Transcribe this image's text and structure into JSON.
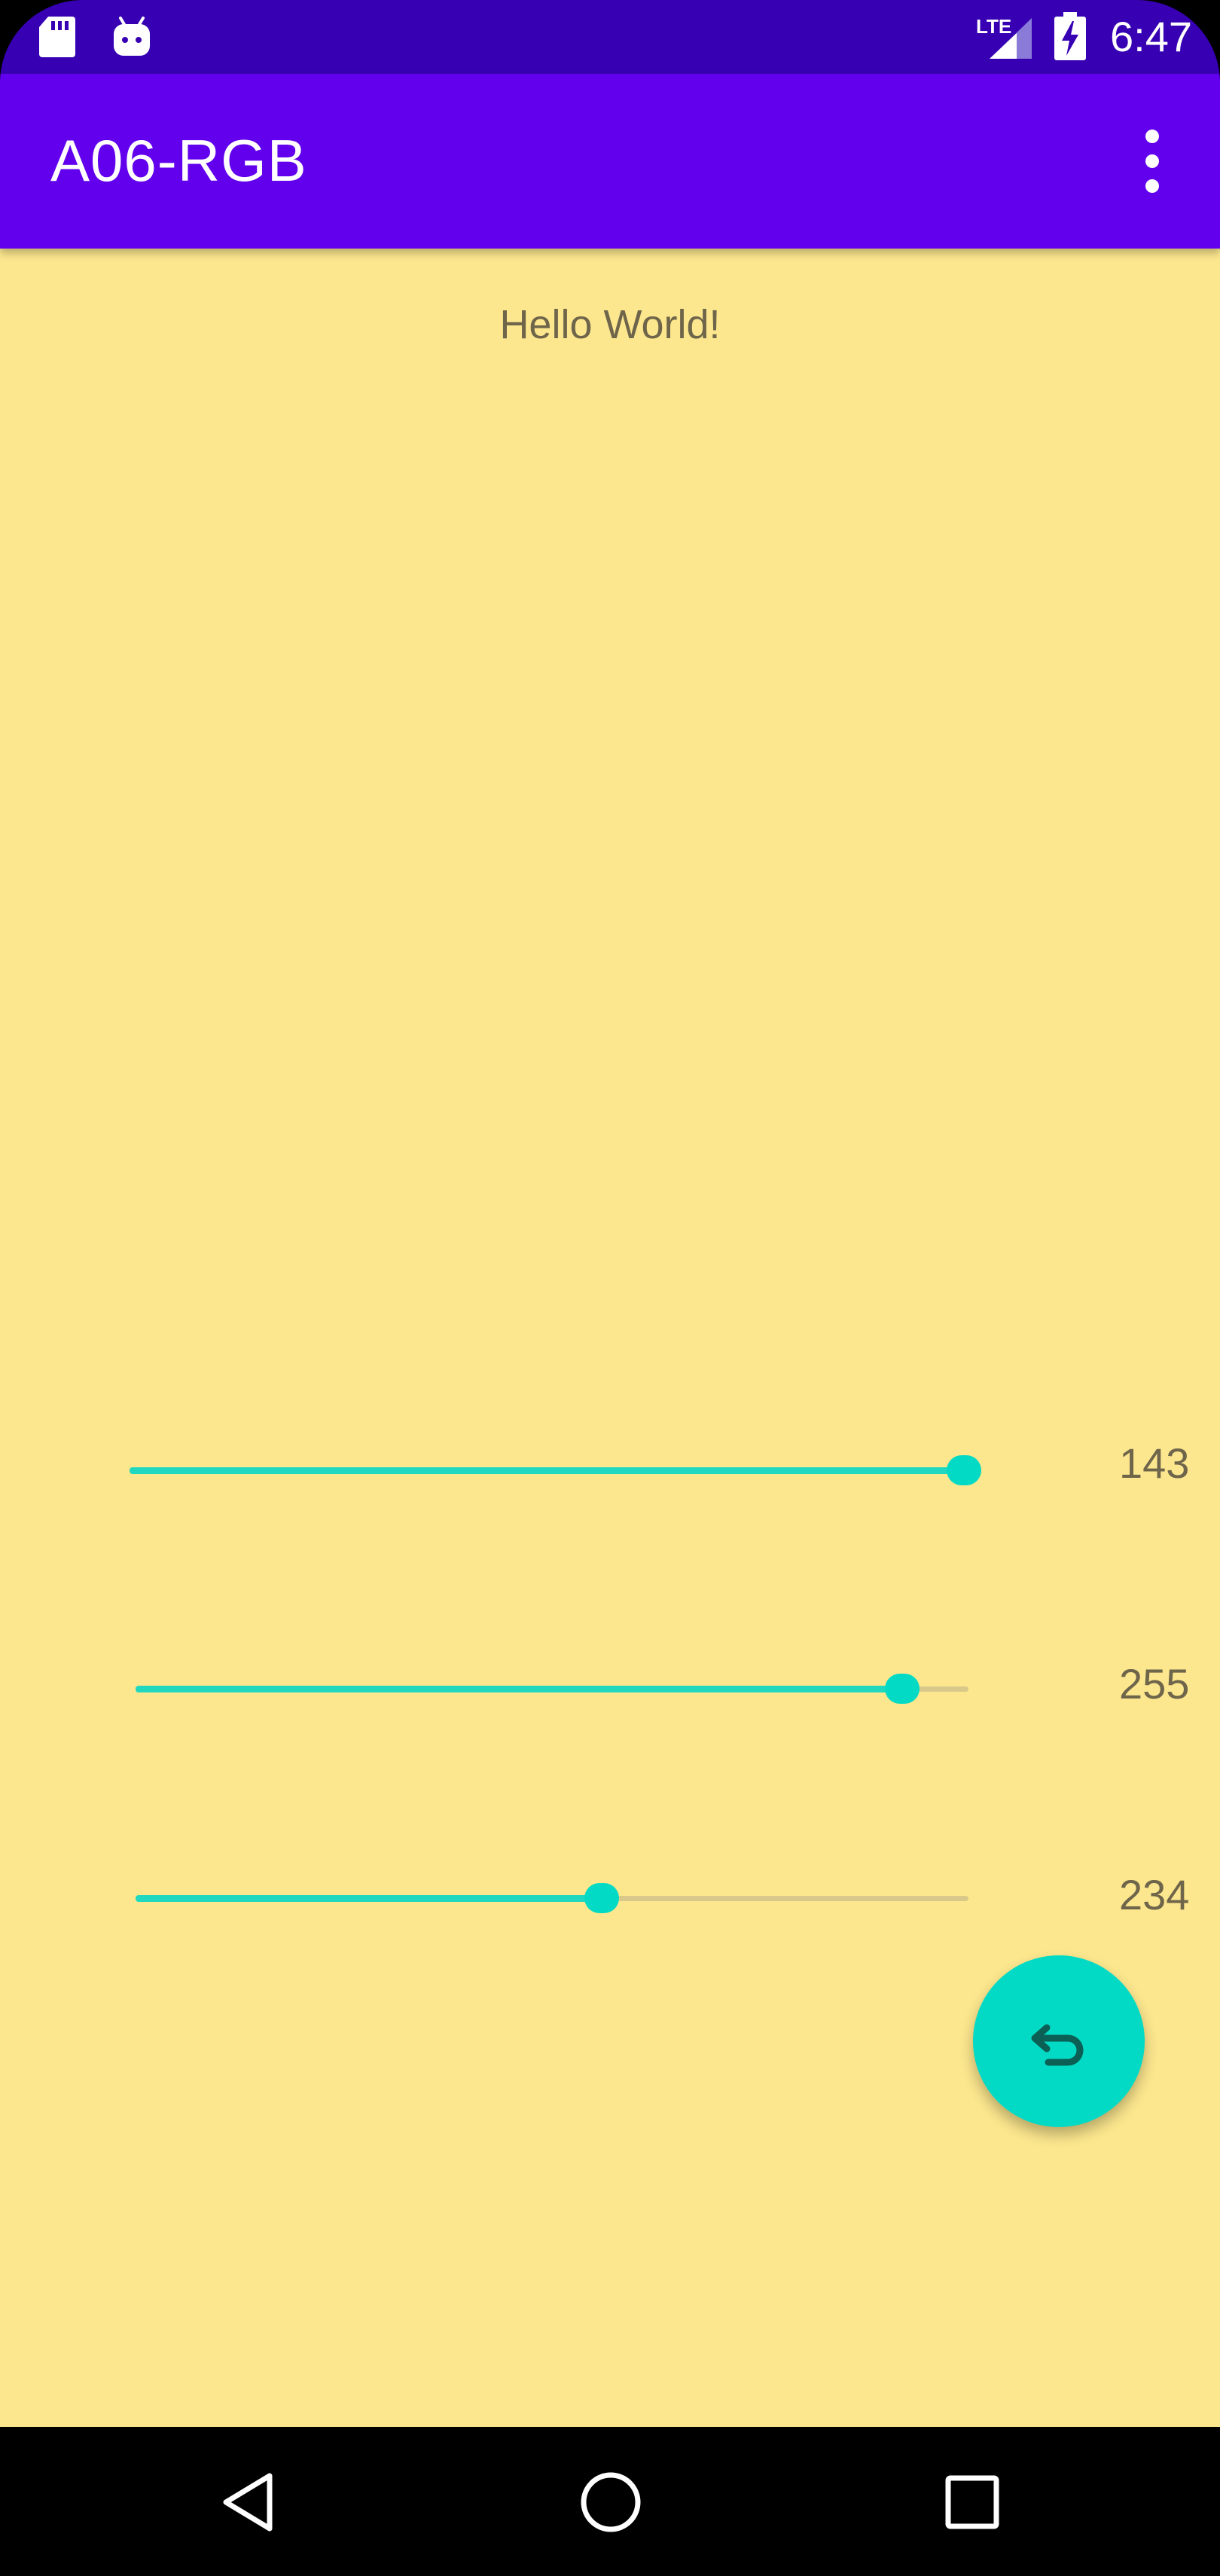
{
  "status_bar": {
    "time": "6:47",
    "network_label": "LTE",
    "left_icons": [
      "sd-card-icon",
      "android-debug-icon"
    ],
    "right_icons": [
      "lte-signal-icon",
      "battery-charging-icon"
    ],
    "background_color": "#3700B3"
  },
  "app_bar": {
    "title": "A06-RGB",
    "overflow_icon": "more-vert-icon",
    "background_color": "#6200EE"
  },
  "main": {
    "background_color": "#FCE78E",
    "greeting": "Hello World!",
    "sliders": [
      {
        "id": "red",
        "value_label": "143",
        "fill_fraction": 1.0
      },
      {
        "id": "green",
        "value_label": "255",
        "fill_fraction": 0.92
      },
      {
        "id": "blue",
        "value_label": "234",
        "fill_fraction": 0.56
      }
    ],
    "accent_color": "#03DAC5"
  },
  "fab": {
    "icon": "undo-icon"
  },
  "nav_bar": {
    "buttons": [
      "back-icon",
      "home-icon",
      "recents-icon"
    ]
  }
}
